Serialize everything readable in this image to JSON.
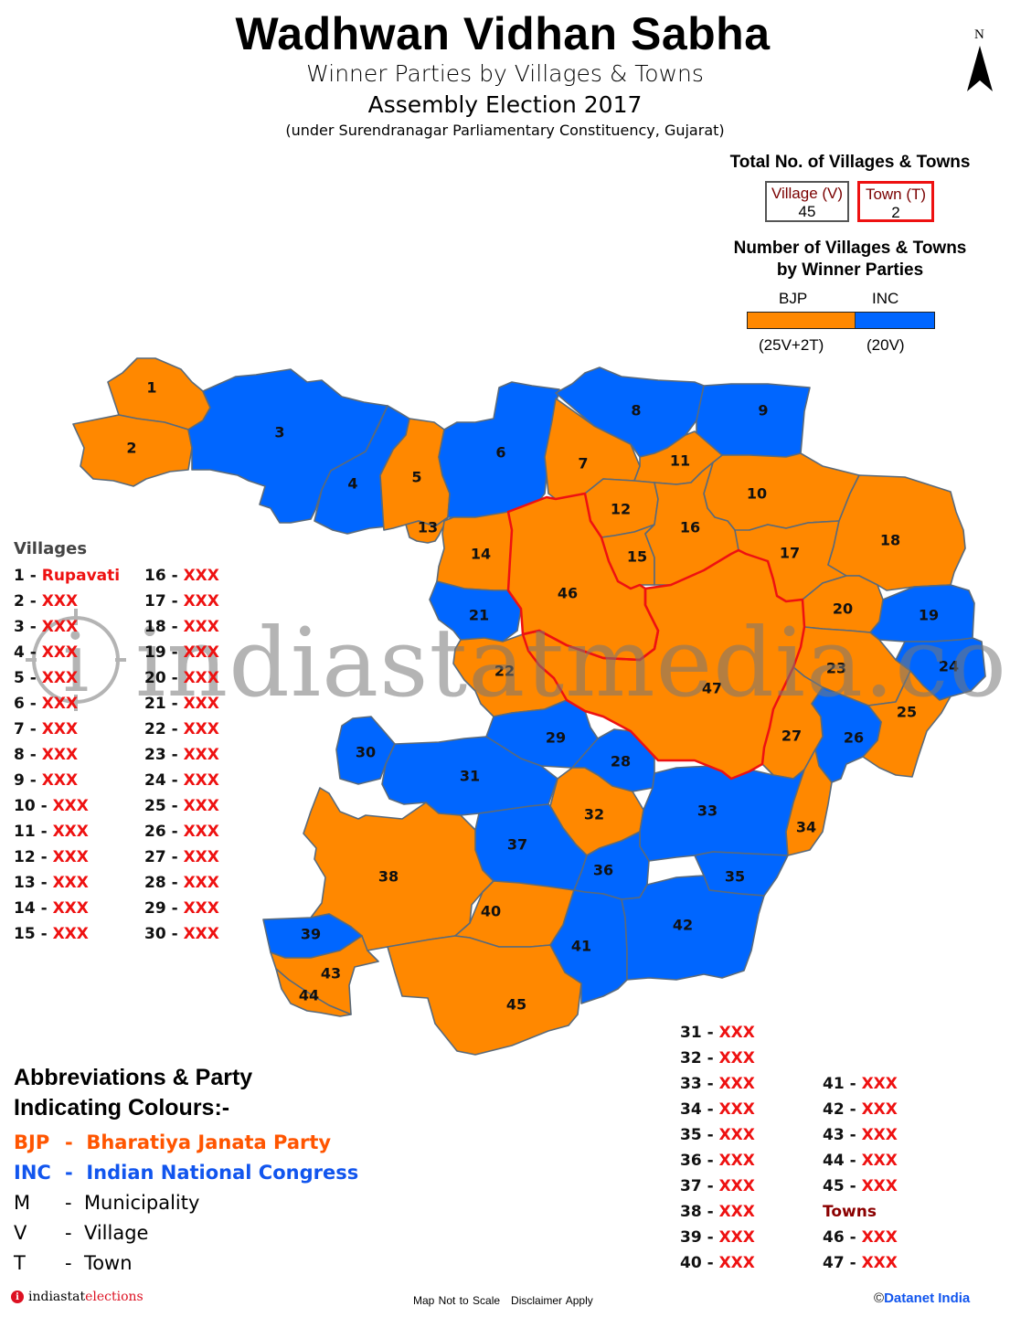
{
  "header": {
    "title": "Wadhwan Vidhan Sabha",
    "subtitle": "Winner Parties by Villages & Towns",
    "election": "Assembly Election 2017",
    "context": "(under Surendranagar Parliamentary Constituency, Gujarat)"
  },
  "north_arrow": {
    "label": "N",
    "icon": "north-arrow-icon"
  },
  "totals": {
    "title": "Total No. of Villages & Towns",
    "village_label": "Village (V)",
    "village_count": "45",
    "town_label": "Town (T)",
    "town_count": "2"
  },
  "winner_summary": {
    "title_line1": "Number of Villages & Towns",
    "title_line2": "by Winner Parties",
    "parties": [
      {
        "party": "BJP",
        "villages": 25,
        "towns": 2,
        "label": "(25V+2T)",
        "color": "#ff8800"
      },
      {
        "party": "INC",
        "villages": 20,
        "towns": 0,
        "label": "(20V)",
        "color": "#0066ff"
      }
    ]
  },
  "colors": {
    "BJP": "#ff8800",
    "INC": "#0066ff",
    "town_boundary": "#ee1111",
    "outer_boundary": "#0a66ee",
    "name_text": "#ee1111"
  },
  "regions": [
    {
      "id": "1",
      "type": "V",
      "name": "Rupavati",
      "winner": "BJP"
    },
    {
      "id": "2",
      "type": "V",
      "name": "XXX",
      "winner": "BJP"
    },
    {
      "id": "3",
      "type": "V",
      "name": "XXX",
      "winner": "INC"
    },
    {
      "id": "4",
      "type": "V",
      "name": "XXX",
      "winner": "INC"
    },
    {
      "id": "5",
      "type": "V",
      "name": "XXX",
      "winner": "BJP"
    },
    {
      "id": "6",
      "type": "V",
      "name": "XXX",
      "winner": "INC"
    },
    {
      "id": "7",
      "type": "V",
      "name": "XXX",
      "winner": "BJP"
    },
    {
      "id": "8",
      "type": "V",
      "name": "XXX",
      "winner": "INC"
    },
    {
      "id": "9",
      "type": "V",
      "name": "XXX",
      "winner": "INC"
    },
    {
      "id": "10",
      "type": "V",
      "name": "XXX",
      "winner": "BJP"
    },
    {
      "id": "11",
      "type": "V",
      "name": "XXX",
      "winner": "BJP"
    },
    {
      "id": "12",
      "type": "V",
      "name": "XXX",
      "winner": "BJP"
    },
    {
      "id": "13",
      "type": "V",
      "name": "XXX",
      "winner": "BJP"
    },
    {
      "id": "14",
      "type": "V",
      "name": "XXX",
      "winner": "BJP"
    },
    {
      "id": "15",
      "type": "V",
      "name": "XXX",
      "winner": "BJP"
    },
    {
      "id": "16",
      "type": "V",
      "name": "XXX",
      "winner": "BJP"
    },
    {
      "id": "17",
      "type": "V",
      "name": "XXX",
      "winner": "BJP"
    },
    {
      "id": "18",
      "type": "V",
      "name": "XXX",
      "winner": "BJP"
    },
    {
      "id": "19",
      "type": "V",
      "name": "XXX",
      "winner": "INC"
    },
    {
      "id": "20",
      "type": "V",
      "name": "XXX",
      "winner": "BJP"
    },
    {
      "id": "21",
      "type": "V",
      "name": "XXX",
      "winner": "INC"
    },
    {
      "id": "22",
      "type": "V",
      "name": "XXX",
      "winner": "BJP"
    },
    {
      "id": "23",
      "type": "V",
      "name": "XXX",
      "winner": "BJP"
    },
    {
      "id": "24",
      "type": "V",
      "name": "XXX",
      "winner": "INC"
    },
    {
      "id": "25",
      "type": "V",
      "name": "XXX",
      "winner": "BJP"
    },
    {
      "id": "26",
      "type": "V",
      "name": "XXX",
      "winner": "INC"
    },
    {
      "id": "27",
      "type": "V",
      "name": "XXX",
      "winner": "BJP"
    },
    {
      "id": "28",
      "type": "V",
      "name": "XXX",
      "winner": "INC"
    },
    {
      "id": "29",
      "type": "V",
      "name": "XXX",
      "winner": "INC"
    },
    {
      "id": "30",
      "type": "V",
      "name": "XXX",
      "winner": "INC"
    },
    {
      "id": "31",
      "type": "V",
      "name": "XXX",
      "winner": "INC"
    },
    {
      "id": "32",
      "type": "V",
      "name": "XXX",
      "winner": "BJP"
    },
    {
      "id": "33",
      "type": "V",
      "name": "XXX",
      "winner": "INC"
    },
    {
      "id": "34",
      "type": "V",
      "name": "XXX",
      "winner": "BJP"
    },
    {
      "id": "35",
      "type": "V",
      "name": "XXX",
      "winner": "INC"
    },
    {
      "id": "36",
      "type": "V",
      "name": "XXX",
      "winner": "INC"
    },
    {
      "id": "37",
      "type": "V",
      "name": "XXX",
      "winner": "INC"
    },
    {
      "id": "38",
      "type": "V",
      "name": "XXX",
      "winner": "BJP"
    },
    {
      "id": "39",
      "type": "V",
      "name": "XXX",
      "winner": "INC"
    },
    {
      "id": "40",
      "type": "V",
      "name": "XXX",
      "winner": "BJP"
    },
    {
      "id": "41",
      "type": "V",
      "name": "XXX",
      "winner": "INC"
    },
    {
      "id": "42",
      "type": "V",
      "name": "XXX",
      "winner": "INC"
    },
    {
      "id": "43",
      "type": "V",
      "name": "XXX",
      "winner": "BJP"
    },
    {
      "id": "44",
      "type": "V",
      "name": "XXX",
      "winner": "BJP"
    },
    {
      "id": "45",
      "type": "V",
      "name": "XXX",
      "winner": "BJP"
    },
    {
      "id": "46",
      "type": "T",
      "name": "XXX",
      "winner": "BJP"
    },
    {
      "id": "47",
      "type": "T",
      "name": "XXX",
      "winner": "BJP"
    }
  ],
  "lists": {
    "villages_heading": "Villages",
    "towns_heading": "Towns",
    "separator": " - "
  },
  "abbreviations": {
    "title_line1": "Abbreviations & Party",
    "title_line2": "Indicating Colours:-",
    "items": [
      {
        "code": "BJP",
        "sep": "-",
        "meaning": "Bharatiya Janata Party"
      },
      {
        "code": "INC",
        "sep": "-",
        "meaning": "Indian National Congress"
      },
      {
        "code": "M",
        "sep": "-",
        "meaning": "Municipality"
      },
      {
        "code": "V",
        "sep": "-",
        "meaning": "Village"
      },
      {
        "code": "T",
        "sep": "-",
        "meaning": "Town"
      }
    ]
  },
  "watermark": {
    "text": "indiastatmedia.com"
  },
  "footer": {
    "brand_part1": "indiastat",
    "brand_part2": "elections",
    "map_note": "Map Not to Scale",
    "disclaimer": "Disclaimer Apply",
    "copyright_symbol": "©",
    "copyright": "Datanet India"
  }
}
